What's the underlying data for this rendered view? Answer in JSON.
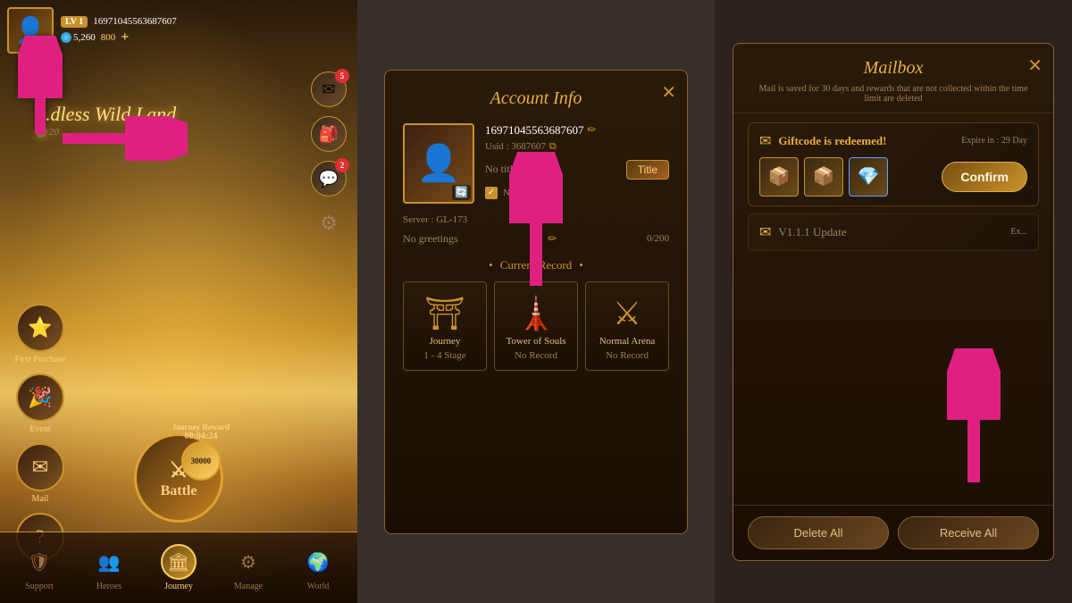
{
  "left": {
    "player": {
      "level": "LV 1",
      "id": "16971045563687607",
      "gems": "5,260",
      "gold": "800"
    },
    "location": {
      "area": "dless Wild Land",
      "prefix": "..."
    },
    "hud": {
      "mail_badge": "5",
      "chat_badge": "2"
    },
    "side_buttons": [
      {
        "label": "First Purchase",
        "icon": "⭐"
      },
      {
        "label": "Event",
        "icon": "🎉"
      }
    ],
    "battle": {
      "label": "Battle",
      "icon": "⚔",
      "journey_reward_label": "Journey Reward",
      "journey_timer": "00:04:24",
      "journey_coins": "30000"
    },
    "nav": [
      {
        "label": "Support",
        "icon": "🛡",
        "active": false
      },
      {
        "label": "Heroes",
        "icon": "👥",
        "active": false
      },
      {
        "label": "Journey",
        "icon": "🏛",
        "active": true
      },
      {
        "label": "Manage",
        "icon": "⚙",
        "active": false
      },
      {
        "label": "World",
        "icon": "🌍",
        "active": false
      }
    ]
  },
  "middle": {
    "modal": {
      "title": "Account Info",
      "close": "✕",
      "username": "16971045563687607",
      "uid_label": "Usid : 3687607",
      "no_title": "No titles",
      "title_btn": "Title",
      "no_greeting": "No greetings",
      "server": "Server : GL-173",
      "char_count": "0/200",
      "current_record_label": "Current Record",
      "records": [
        {
          "name": "Journey",
          "value": "1 - 4 Stage",
          "icon": "⛩"
        },
        {
          "name": "Tower of Souls",
          "value": "No Record",
          "icon": "🗼"
        },
        {
          "name": "Normal Arena",
          "value": "No Record",
          "icon": "⚔"
        }
      ]
    }
  },
  "right": {
    "modal": {
      "title": "Mailbox",
      "close": "✕",
      "subtitle": "Mail is saved for 30 days and rewards that are not collected within the time limit are deleted",
      "mails": [
        {
          "subject": "Giftcode is redeemed!",
          "expire": "Expire in : 29 Day",
          "rewards": [
            "📦",
            "📦",
            "💎"
          ],
          "confirm_btn": "Confirm"
        },
        {
          "subject": "V1.1.1 Update",
          "expire": "Ex..."
        }
      ],
      "footer": {
        "delete_all": "Delete All",
        "receive_all": "Receive All"
      }
    }
  }
}
